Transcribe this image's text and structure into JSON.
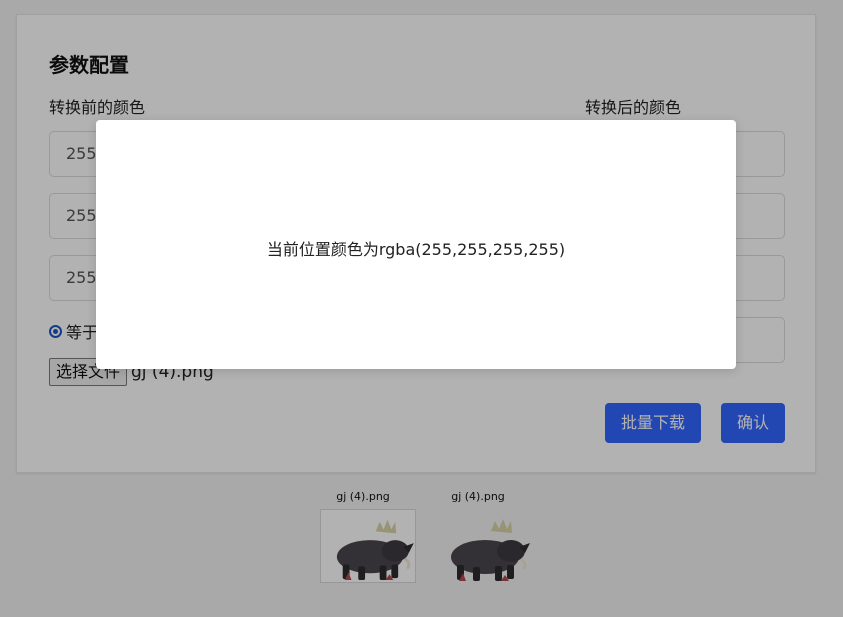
{
  "form": {
    "title": "参数配置",
    "before_label": "转换前的颜色",
    "after_label": "转换后的颜色",
    "before_fields": [
      "255",
      "255",
      "255"
    ],
    "radio_label": "等于",
    "file_button": "选择文件",
    "file_name": "gj (4).png",
    "batch_download": "批量下载",
    "confirm": "确认"
  },
  "thumbnails": [
    {
      "name": "gj (4).png"
    },
    {
      "name": "gj (4).png"
    }
  ],
  "modal": {
    "message": "当前位置颜色为rgba(255,255,255,255)"
  },
  "colors": {
    "primary": "#3366ff",
    "overlay": "rgba(0,0,0,0.30)"
  }
}
